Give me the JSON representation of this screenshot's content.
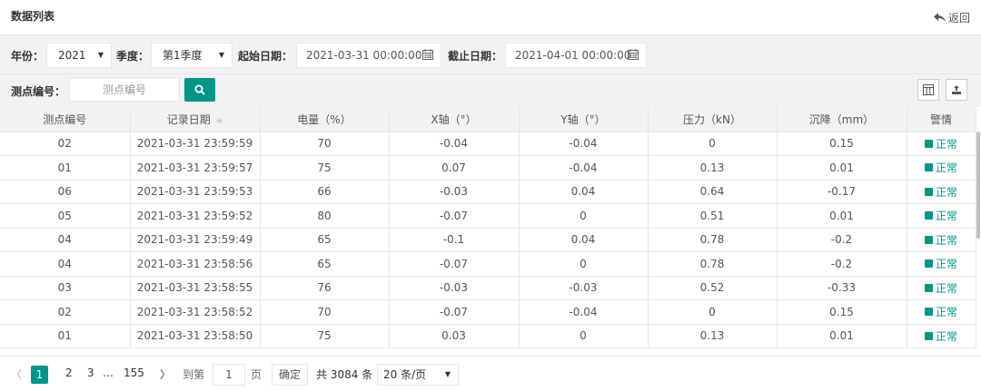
{
  "header": {
    "title": "数据列表",
    "back_label": "返回"
  },
  "filters": {
    "year_label": "年份：",
    "year_value": "2021",
    "season_label": "季度：",
    "season_value": "第1季度",
    "start_label": "起始日期：",
    "start_value": "2021-03-31 00:00:00",
    "end_label": "截止日期：",
    "end_value": "2021-04-01 00:00:00"
  },
  "search": {
    "label": "测点编号：",
    "placeholder": "测点编号"
  },
  "table": {
    "columns": [
      "测点编号",
      "记录日期",
      "电量（%）",
      "X轴（°）",
      "Y轴（°）",
      "压力（kN）",
      "沉降（mm）",
      "警情"
    ],
    "sort_glyph": "≑",
    "rows": [
      [
        "02",
        "2021-03-31 23:59:59",
        "70",
        "-0.04",
        "-0.04",
        "0",
        "0.15",
        "正常"
      ],
      [
        "01",
        "2021-03-31 23:59:57",
        "75",
        "0.07",
        "-0.04",
        "0.13",
        "0.01",
        "正常"
      ],
      [
        "06",
        "2021-03-31 23:59:53",
        "66",
        "-0.03",
        "0.04",
        "0.64",
        "-0.17",
        "正常"
      ],
      [
        "05",
        "2021-03-31 23:59:52",
        "80",
        "-0.07",
        "0",
        "0.51",
        "0.01",
        "正常"
      ],
      [
        "04",
        "2021-03-31 23:59:49",
        "65",
        "-0.1",
        "0.04",
        "0.78",
        "-0.2",
        "正常"
      ],
      [
        "04",
        "2021-03-31 23:58:56",
        "65",
        "-0.07",
        "0",
        "0.78",
        "-0.2",
        "正常"
      ],
      [
        "03",
        "2021-03-31 23:58:55",
        "76",
        "-0.03",
        "-0.03",
        "0.52",
        "-0.33",
        "正常"
      ],
      [
        "02",
        "2021-03-31 23:58:52",
        "70",
        "-0.07",
        "-0.04",
        "0",
        "0.15",
        "正常"
      ],
      [
        "01",
        "2021-03-31 23:58:50",
        "75",
        "0.03",
        "0",
        "0.13",
        "0.01",
        "正常"
      ]
    ]
  },
  "pagination": {
    "prev": "〈",
    "current": "1",
    "page2": "2",
    "page3": "3",
    "ellipsis": "…",
    "last": "155",
    "next": "〉",
    "goto_label": "到第",
    "goto_value": "1",
    "page_unit": "页",
    "confirm": "确定",
    "total": "共 3084 条",
    "page_size": "20 条/页"
  },
  "colors": {
    "accent": "#009688",
    "header_bg": "#f2f2f2",
    "border": "#e6e6e6"
  }
}
